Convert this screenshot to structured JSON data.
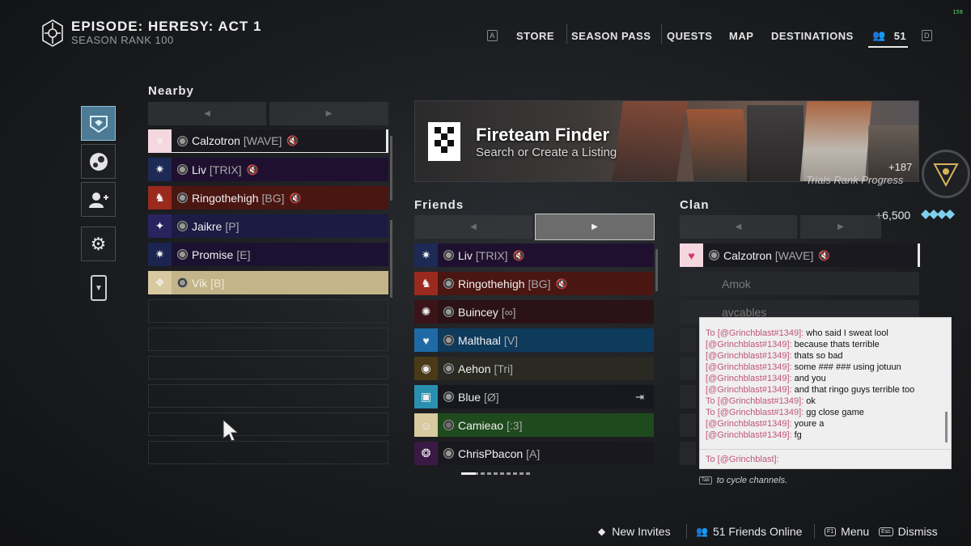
{
  "header": {
    "title": "EPISODE: HERESY: ACT 1",
    "subtitle_prefix": "SEASON RANK",
    "season_rank": "100",
    "fps": "158"
  },
  "nav": {
    "key_left": "A",
    "items": [
      "STORE",
      "SEASON PASS",
      "QUESTS",
      "MAP",
      "DESTINATIONS"
    ],
    "friends_count": "51",
    "key_right": "D"
  },
  "rail": {
    "icons": [
      "clan-banner-icon",
      "steam-icon",
      "add-friend-icon",
      "settings-gear-icon",
      "companion-phone-icon"
    ]
  },
  "nearby": {
    "heading": "Nearby",
    "rows": [
      {
        "name": "Calzotron",
        "tag": "[WAVE]",
        "muted": true,
        "color": "#1a1920",
        "emblem_color": "#f5d7e0",
        "emblem_glyph": "♥"
      },
      {
        "name": "Liv",
        "tag": "[TRIX]",
        "muted": true,
        "color": "#1f1030",
        "emblem_color": "#1c2a55",
        "emblem_glyph": "✷"
      },
      {
        "name": "Ringothehigh",
        "tag": "[BG]",
        "muted": true,
        "color": "#4a1612",
        "emblem_color": "#9a2a1e",
        "emblem_glyph": "♞"
      },
      {
        "name": "Jaikre",
        "tag": "[P]",
        "muted": false,
        "color": "#1c1b44",
        "emblem_color": "#2a2360",
        "emblem_glyph": "✦"
      },
      {
        "name": "Promise",
        "tag": "[E]",
        "muted": false,
        "color": "#1b1130",
        "emblem_color": "#1b2550",
        "emblem_glyph": "✷"
      },
      {
        "name": "Vik",
        "tag": "[B]",
        "muted": false,
        "color": "#c4b48a",
        "emblem_color": "#d9c9a0",
        "emblem_glyph": "❖"
      }
    ]
  },
  "fireteam_finder": {
    "title": "Fireteam Finder",
    "subtitle": "Search or Create a Listing"
  },
  "trials": {
    "value": "+187",
    "label": "Trials Rank Progress"
  },
  "bright_dust": {
    "value": "+6,500"
  },
  "friends": {
    "heading": "Friends",
    "rows": [
      {
        "name": "Liv",
        "tag": "[TRIX]",
        "muted": true,
        "xbox": false,
        "join": false,
        "color": "#1f1030",
        "emblem_color": "#1c2a55",
        "emblem_glyph": "✷"
      },
      {
        "name": "Ringothehigh",
        "tag": "[BG]",
        "muted": true,
        "xbox": false,
        "join": false,
        "color": "#4a1612",
        "emblem_color": "#9a2a1e",
        "emblem_glyph": "♞"
      },
      {
        "name": "Buincey",
        "tag": "[∞]",
        "muted": false,
        "xbox": false,
        "join": false,
        "color": "#2a1216",
        "emblem_color": "#3a1418",
        "emblem_glyph": "✺"
      },
      {
        "name": "Malthaal",
        "tag": "[V]",
        "muted": false,
        "xbox": false,
        "join": false,
        "color": "#0e3a5c",
        "emblem_color": "#1f6aa6",
        "emblem_glyph": "♥"
      },
      {
        "name": "Aehon",
        "tag": "[Tri]",
        "muted": false,
        "xbox": false,
        "join": false,
        "color": "#2a2a22",
        "emblem_color": "#4a3a18",
        "emblem_glyph": "◉"
      },
      {
        "name": "Blue",
        "tag": "[Ø]",
        "muted": false,
        "xbox": false,
        "join": true,
        "color": "#15181c",
        "emblem_color": "#2a8fb0",
        "emblem_glyph": "▣"
      },
      {
        "name": "Camieao",
        "tag": "[:3]",
        "muted": false,
        "xbox": true,
        "join": false,
        "color": "#1f4a1d",
        "emblem_color": "#d9caa0",
        "emblem_glyph": "☺"
      },
      {
        "name": "ChrisPbacon",
        "tag": "[A]",
        "muted": false,
        "xbox": false,
        "join": false,
        "color": "#1a181f",
        "emblem_color": "#3a1a44",
        "emblem_glyph": "❂"
      }
    ]
  },
  "clan": {
    "heading": "Clan",
    "rows": [
      {
        "name": "Calzotron",
        "tag": "[WAVE]",
        "muted": true
      },
      {
        "name": "Amok",
        "tag": ""
      },
      {
        "name": "avcables",
        "tag": ""
      }
    ]
  },
  "chat": {
    "lines": [
      {
        "prefix": "To ",
        "who": "[@Grinchblast#1349]:",
        "text": " who said I sweat lool"
      },
      {
        "prefix": "",
        "who": "[@Grinchblast#1349]:",
        "text": " because thats terrible"
      },
      {
        "prefix": "",
        "who": "[@Grinchblast#1349]:",
        "text": " thats so bad"
      },
      {
        "prefix": "",
        "who": "[@Grinchblast#1349]:",
        "text": " some ### ### using jotuun"
      },
      {
        "prefix": "",
        "who": "[@Grinchblast#1349]:",
        "text": " and you"
      },
      {
        "prefix": "",
        "who": "[@Grinchblast#1349]:",
        "text": " and that ringo guys terrible too"
      },
      {
        "prefix": "To ",
        "who": "[@Grinchblast#1349]:",
        "text": " ok"
      },
      {
        "prefix": "To ",
        "who": "[@Grinchblast#1349]:",
        "text": " gg close game"
      },
      {
        "prefix": "",
        "who": "[@Grinchblast#1349]:",
        "text": " youre a"
      },
      {
        "prefix": "",
        "who": "[@Grinchblast#1349]:",
        "text": " fg"
      }
    ],
    "input_prefix": "To [@Grinchblast]:",
    "hint_key": "Tab",
    "hint": "to cycle channels."
  },
  "bottom_bar": {
    "new_invites": "New Invites",
    "friends_online": "51 Friends Online",
    "menu_key": "F1",
    "menu": "Menu",
    "dismiss_key": "Esc",
    "dismiss": "Dismiss"
  }
}
